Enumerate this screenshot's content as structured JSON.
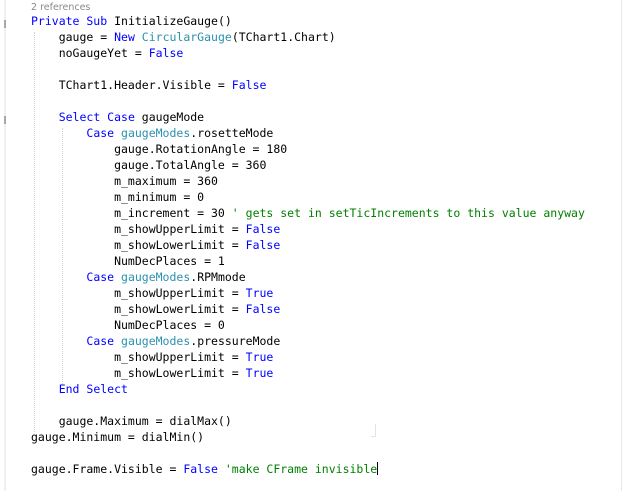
{
  "codelens": "2 references",
  "lines": [
    [
      {
        "t": "Private Sub ",
        "c": "kw"
      },
      {
        "t": "InitializeGauge()"
      }
    ],
    [
      {
        "t": "    gauge = "
      },
      {
        "t": "New ",
        "c": "kw"
      },
      {
        "t": "CircularGauge",
        "c": "ty"
      },
      {
        "t": "(TChart1.Chart)"
      }
    ],
    [
      {
        "t": "    noGaugeYet = "
      },
      {
        "t": "False",
        "c": "kw"
      }
    ],
    [],
    [
      {
        "t": "    TChart1.Header.Visible = "
      },
      {
        "t": "False",
        "c": "kw"
      }
    ],
    [],
    [
      {
        "t": "    "
      },
      {
        "t": "Select Case ",
        "c": "kw"
      },
      {
        "t": "gaugeMode"
      }
    ],
    [
      {
        "t": "        "
      },
      {
        "t": "Case ",
        "c": "kw"
      },
      {
        "t": "gaugeModes",
        "c": "ty"
      },
      {
        "t": ".rosetteMode"
      }
    ],
    [
      {
        "t": "            gauge.RotationAngle = 180"
      }
    ],
    [
      {
        "t": "            gauge.TotalAngle = 360"
      }
    ],
    [
      {
        "t": "            m_maximum = 360"
      }
    ],
    [
      {
        "t": "            m_minimum = 0"
      }
    ],
    [
      {
        "t": "            m_increment = 30 "
      },
      {
        "t": "' gets set in setTicIncrements to this value anyway",
        "c": "cm"
      }
    ],
    [
      {
        "t": "            m_showUpperLimit = "
      },
      {
        "t": "False",
        "c": "kw"
      }
    ],
    [
      {
        "t": "            m_showLowerLimit = "
      },
      {
        "t": "False",
        "c": "kw"
      }
    ],
    [
      {
        "t": "            NumDecPlaces = 1"
      }
    ],
    [
      {
        "t": "        "
      },
      {
        "t": "Case ",
        "c": "kw"
      },
      {
        "t": "gaugeModes",
        "c": "ty"
      },
      {
        "t": ".RPMmode"
      }
    ],
    [
      {
        "t": "            m_showUpperLimit = "
      },
      {
        "t": "True",
        "c": "kw"
      }
    ],
    [
      {
        "t": "            m_showLowerLimit = "
      },
      {
        "t": "False",
        "c": "kw"
      }
    ],
    [
      {
        "t": "            NumDecPlaces = 0"
      }
    ],
    [
      {
        "t": "        "
      },
      {
        "t": "Case ",
        "c": "kw"
      },
      {
        "t": "gaugeModes",
        "c": "ty"
      },
      {
        "t": ".pressureMode"
      }
    ],
    [
      {
        "t": "            m_showUpperLimit = "
      },
      {
        "t": "True",
        "c": "kw"
      }
    ],
    [
      {
        "t": "            m_showLowerLimit = "
      },
      {
        "t": "True",
        "c": "kw"
      }
    ],
    [
      {
        "t": "    "
      },
      {
        "t": "End Select",
        "c": "kw"
      }
    ],
    [],
    [
      {
        "t": "    gauge.Maximum = dialMax()"
      }
    ],
    [
      {
        "t": "gauge.Minimum = dialMin()"
      }
    ],
    [],
    [
      {
        "t": "gauge.Frame.Visible = "
      },
      {
        "t": "False ",
        "c": "kw"
      },
      {
        "t": "'make CFrame invisible",
        "c": "cm"
      }
    ]
  ],
  "caret_line": 28
}
